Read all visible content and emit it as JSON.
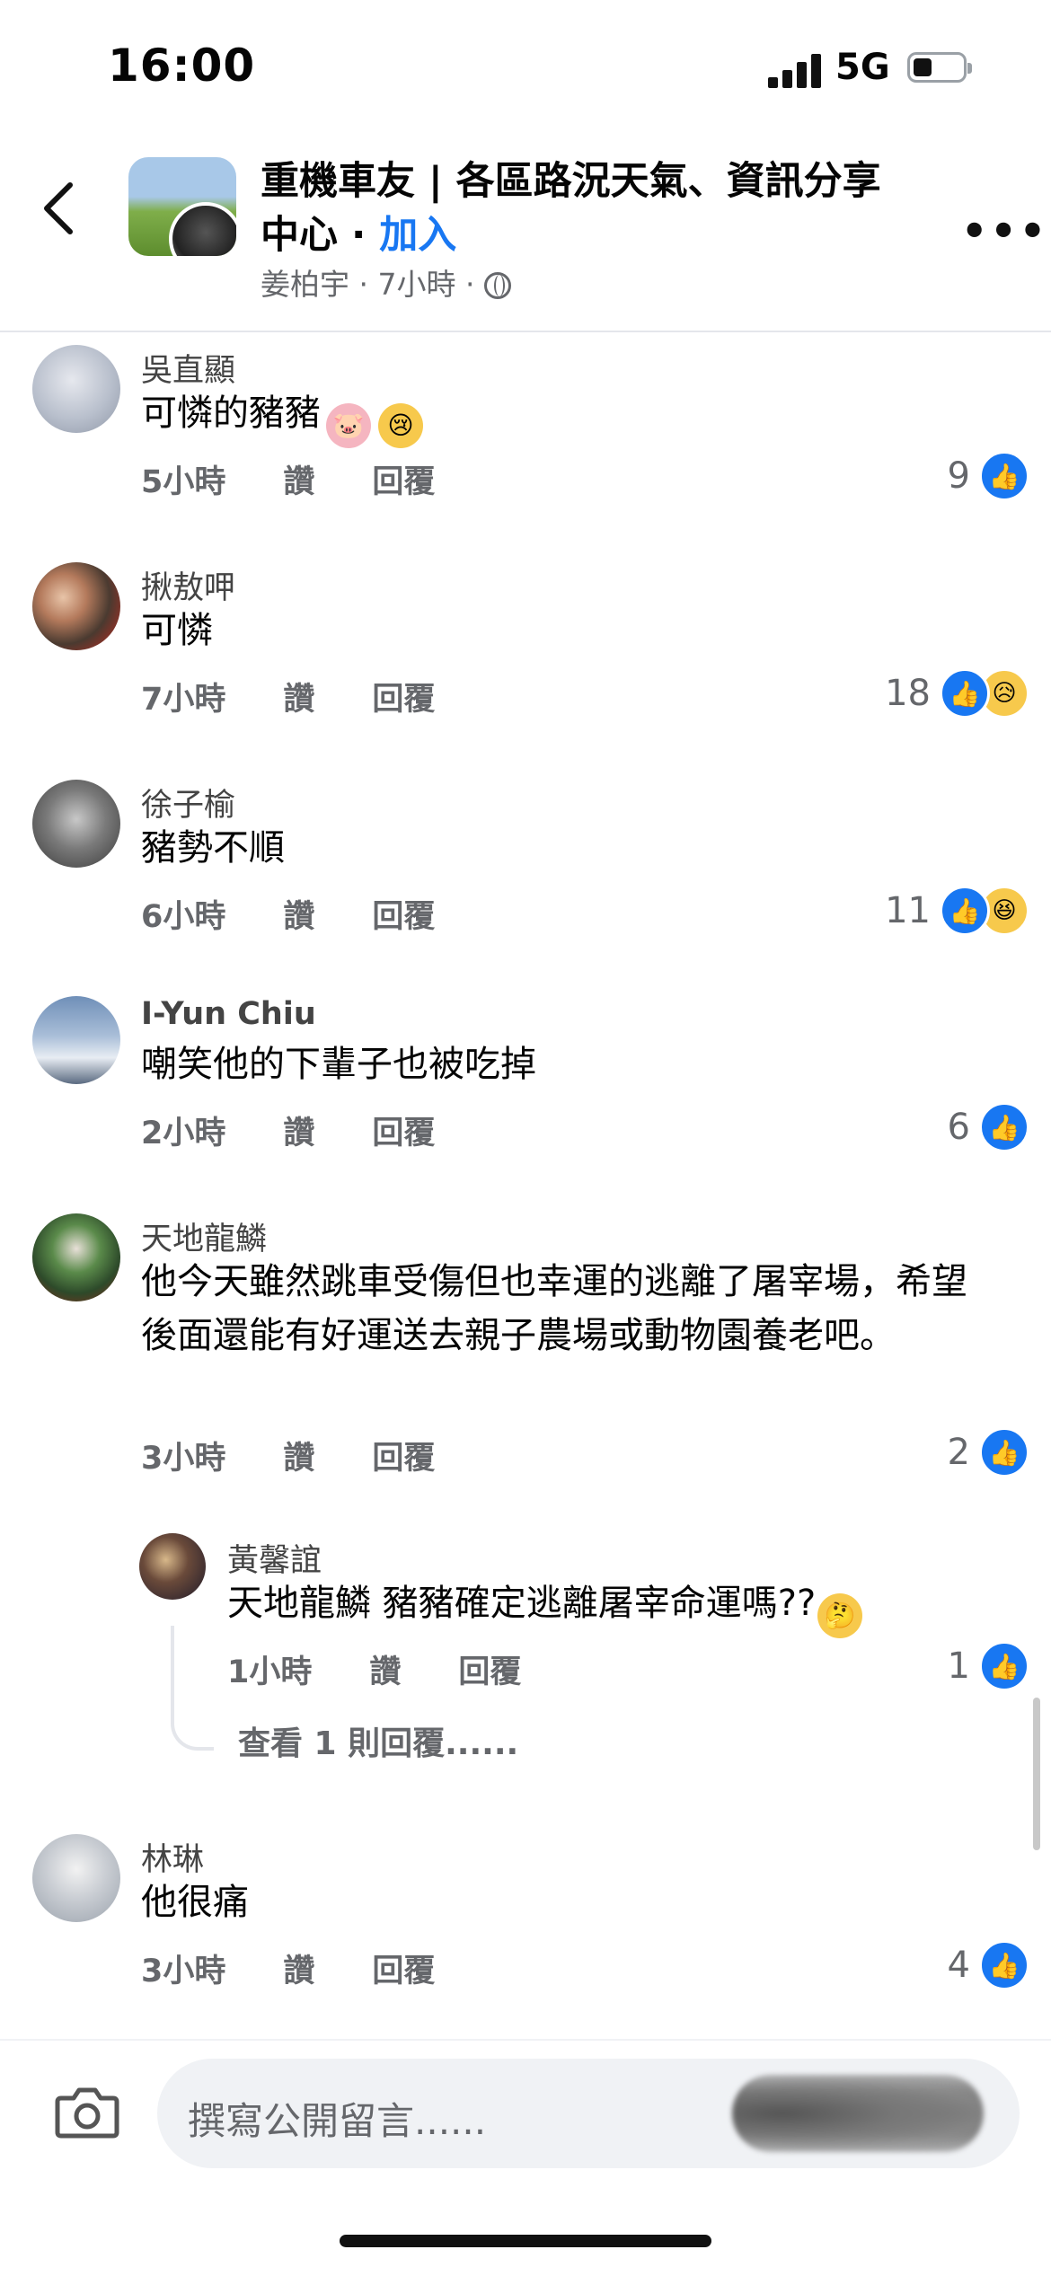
{
  "status_bar": {
    "time": "16:00",
    "network": "5G"
  },
  "header": {
    "group_name": "重機車友 | 各區路況天氣、資訊分享中心 · ",
    "join_label": "加入",
    "author": "姜柏宇",
    "time_ago": "7小時",
    "separator": " · "
  },
  "comments": [
    {
      "name": "吳直顯",
      "text": "可憐的豬豬",
      "emojis": [
        "pig-face",
        "crying-face"
      ],
      "time": "5小時",
      "like_label": "讚",
      "reply_label": "回覆",
      "reaction_count": "9",
      "reactions": [
        "like"
      ]
    },
    {
      "name": "揪敖呷",
      "text": "可憐",
      "time": "7小時",
      "like_label": "讚",
      "reply_label": "回覆",
      "reaction_count": "18",
      "reactions": [
        "like",
        "sad"
      ]
    },
    {
      "name": "徐子榆",
      "text": "豬勢不順",
      "time": "6小時",
      "like_label": "讚",
      "reply_label": "回覆",
      "reaction_count": "11",
      "reactions": [
        "like",
        "haha"
      ]
    },
    {
      "name": "I-Yun Chiu",
      "text": "嘲笑他的下輩子也被吃掉",
      "time": "2小時",
      "like_label": "讚",
      "reply_label": "回覆",
      "reaction_count": "6",
      "reactions": [
        "like"
      ]
    },
    {
      "name": "天地龍鱗",
      "text": "他今天雖然跳車受傷但也幸運的逃離了屠宰場，希望後面還能有好運送去親子農場或動物園養老吧。",
      "time": "3小時",
      "like_label": "讚",
      "reply_label": "回覆",
      "reaction_count": "2",
      "reactions": [
        "like"
      ]
    },
    {
      "name": "林琳",
      "text": "他很痛",
      "time": "3小時",
      "like_label": "讚",
      "reply_label": "回覆",
      "reaction_count": "4",
      "reactions": [
        "like"
      ]
    }
  ],
  "reply": {
    "name": "黃馨誼",
    "mention": "天地龍鱗",
    "text": " 豬豬確定逃離屠宰命運嗎??",
    "emoji": "thinking-face",
    "time": "1小時",
    "like_label": "讚",
    "reply_label": "回覆",
    "reaction_count": "1",
    "view_more": "查看 1 則回覆......"
  },
  "composer": {
    "placeholder": "撰寫公開留言......"
  },
  "colors": {
    "accent": "#1877f2",
    "secondary_text": "#65676b",
    "reaction_yellow": "#f7c94c"
  }
}
